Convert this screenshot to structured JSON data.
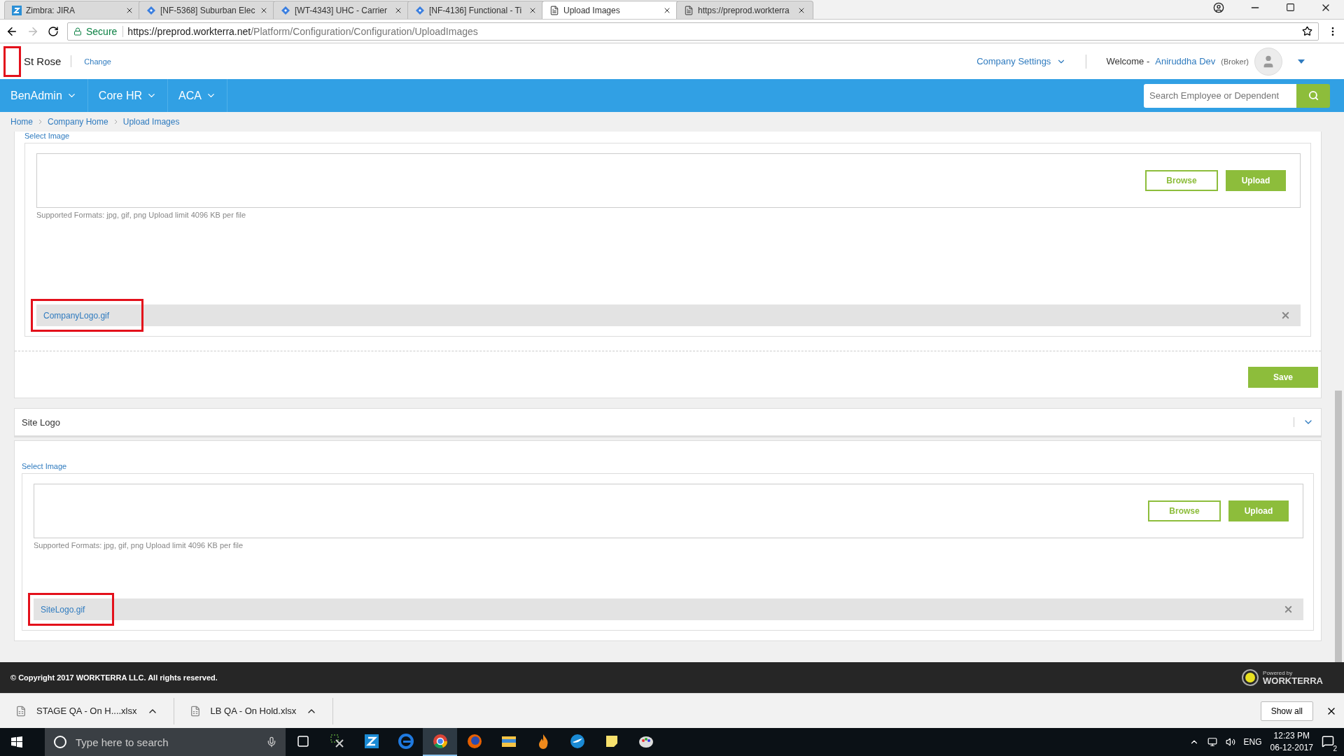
{
  "browser": {
    "tabs": [
      {
        "label": "Zimbra: JIRA",
        "kind": "jira",
        "selected": false
      },
      {
        "label": "[NF-5368] Suburban Elec",
        "kind": "issue",
        "selected": false
      },
      {
        "label": "[WT-4343] UHC - Carrier",
        "kind": "issue",
        "selected": false
      },
      {
        "label": "[NF-4136] Functional - Ti",
        "kind": "issue",
        "selected": false
      },
      {
        "label": "Upload Images",
        "kind": "page",
        "selected": true
      },
      {
        "label": "https://preprod.workterra",
        "kind": "page",
        "selected": false
      }
    ],
    "secure_label": "Secure",
    "url_host": "https://preprod.workterra.net",
    "url_path": "/Platform/Configuration/Configuration/UploadImages"
  },
  "header": {
    "logo_highlighted": true,
    "company": "St Rose",
    "change_link": "Change",
    "settings_menu": "Company Settings",
    "welcome": "Welcome -",
    "user_name": "Aniruddha Dev",
    "user_role": "(Broker)"
  },
  "nav": {
    "items": [
      "BenAdmin",
      "Core HR",
      "ACA"
    ],
    "search": {
      "placeholder": "Search Employee or Dependent"
    }
  },
  "breadcrumb": [
    "Home",
    "Company Home",
    "Upload Images"
  ],
  "sections": [
    {
      "select_label": "Select Image",
      "browse": "Browse",
      "upload": "Upload",
      "hint": "Supported Formats: jpg, gif, png Upload limit 4096 KB per file",
      "file": "CompanyLogo.gif",
      "file_highlighted": true,
      "save": "Save"
    },
    {
      "title": "Site Logo",
      "expanded": true,
      "select_label": "Select Image",
      "browse": "Browse",
      "upload": "Upload",
      "hint": "Supported Formats: jpg, gif, png Upload limit 4096 KB per file",
      "file": "SiteLogo.gif",
      "file_highlighted": true
    }
  ],
  "footer": {
    "copyright": "© Copyright 2017 WORKTERRA LLC. All rights reserved.",
    "powered_by": "Powered by",
    "brand": "WORKTERRA"
  },
  "downloads": {
    "items": [
      "STAGE QA - On H....xlsx",
      "LB QA - On Hold.xlsx"
    ],
    "show_all": "Show all"
  },
  "taskbar": {
    "search_placeholder": "Type here to search",
    "apps": [
      {
        "kind": "taskview",
        "selected": false
      },
      {
        "kind": "tools",
        "selected": false
      },
      {
        "kind": "zimbra",
        "selected": false
      },
      {
        "kind": "edge",
        "selected": false
      },
      {
        "kind": "chrome",
        "selected": true
      },
      {
        "kind": "firefox",
        "selected": false
      },
      {
        "kind": "explorer",
        "selected": false
      },
      {
        "kind": "flame",
        "selected": false
      },
      {
        "kind": "bird",
        "selected": false
      },
      {
        "kind": "notes",
        "selected": false
      },
      {
        "kind": "paint",
        "selected": false
      }
    ],
    "lang": "ENG",
    "time": "12:23 PM",
    "date": "06-12-2017",
    "notifications": "2"
  }
}
